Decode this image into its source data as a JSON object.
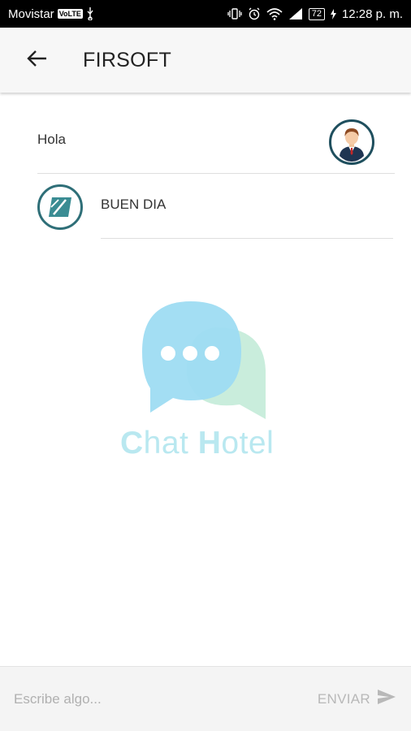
{
  "status_bar": {
    "carrier": "Movistar",
    "volte": "VoLTE",
    "battery": "72",
    "time": "12:28 p. m."
  },
  "app_bar": {
    "title": "FIRSOFT"
  },
  "messages": [
    {
      "text": "Hola",
      "direction": "sent"
    },
    {
      "text": "BUEN DIA",
      "direction": "received"
    }
  ],
  "watermark": {
    "brand_c": "C",
    "brand_hat": "hat ",
    "brand_h": "H",
    "brand_otel": "otel"
  },
  "composer": {
    "placeholder": "Escribe algo...",
    "send_label": "ENVIAR"
  },
  "colors": {
    "bubble_blue": "#9edcf2",
    "bubble_green": "#c9eddc",
    "brand_text": "#b9e8f0",
    "avatar_ring": "#1f4f5e"
  }
}
